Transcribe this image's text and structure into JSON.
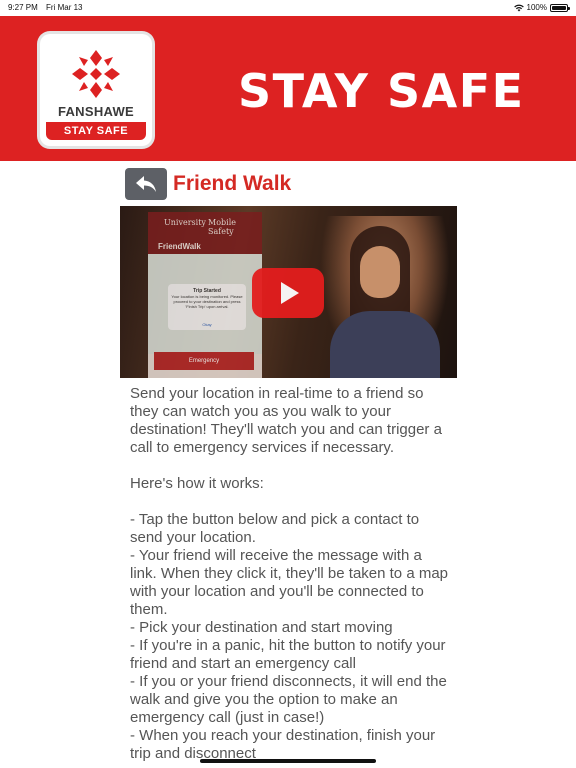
{
  "status": {
    "time": "9:27 PM",
    "date": "Fri Mar 13",
    "battery": "100%"
  },
  "banner": {
    "logo_name": "FANSHAWE",
    "logo_tag": "STAY SAFE",
    "title": "STAY SAFE",
    "color": "#dd2222"
  },
  "header": {
    "title": "Friend Walk",
    "back_icon": "back-arrow-icon"
  },
  "video": {
    "phone_univ": "University",
    "phone_mobile": "Mobile Safety",
    "phone_app": "FriendWalk",
    "dialog_title": "Trip Started",
    "dialog_body": "Your location is being monitored. Please proceed to your destination and press 'Finish Trip' upon arrival.",
    "dialog_ok": "Okay",
    "emergency": "Emergency"
  },
  "content": {
    "intro": "Send your location in real-time to a friend so they can watch you as you walk to your destination! They'll watch you and can trigger a call to emergency services if necessary.",
    "how_heading": "Here's how it works:",
    "steps": [
      "- Tap the button below and pick a contact to send your location.",
      "- Your friend will receive the message with a link. When they click it, they'll be taken to a map with your location and you'll be connected to them.",
      "- Pick your destination and start moving",
      "- If you're in a panic, hit the button to notify your friend and start an emergency call",
      "- If you or your friend disconnects, it will end the walk and give you the option to make an emergency call (just in case!)",
      "- When you reach your destination, finish your trip and disconnect"
    ]
  }
}
